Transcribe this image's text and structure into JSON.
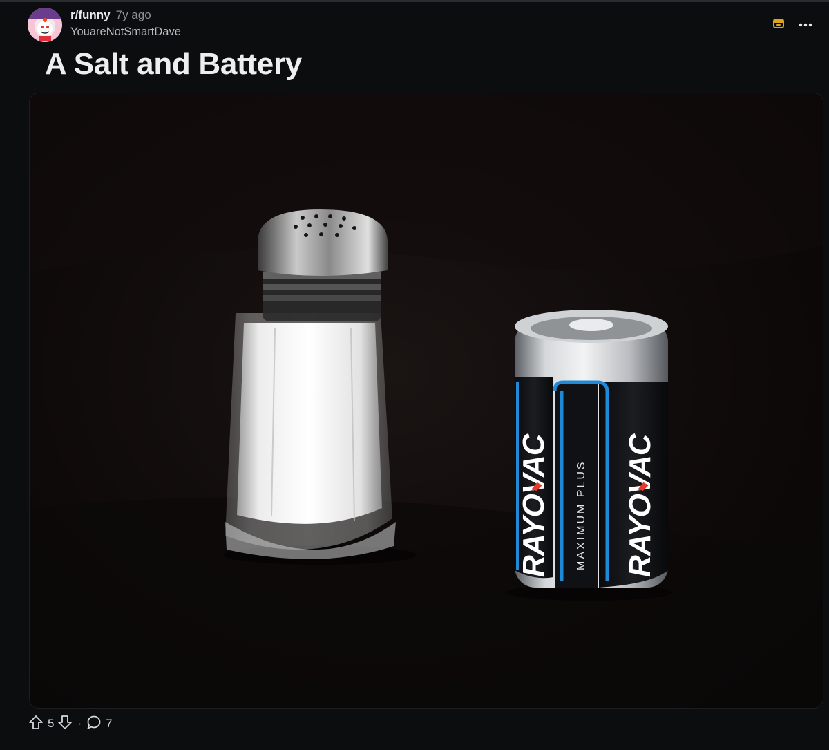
{
  "post": {
    "subreddit": "r/funny",
    "time_ago": "7y ago",
    "author": "YouareNotSmartDave",
    "title": "A Salt and Battery",
    "image": {
      "battery_brand": "RAYOVAC",
      "battery_line": "MAXIMUM PLUS"
    }
  },
  "actions": {
    "upvotes": "5",
    "separator": "·",
    "comments": "7"
  },
  "icons": {
    "save": "bookmark-icon",
    "more": "more-options-icon",
    "upvote": "upvote-arrow-icon",
    "downvote": "downvote-arrow-icon",
    "comment": "comment-bubble-icon"
  },
  "colors": {
    "background": "#0b0d0f",
    "save_icon": "#e0a41c",
    "battery_blue": "#1e8ad8"
  }
}
